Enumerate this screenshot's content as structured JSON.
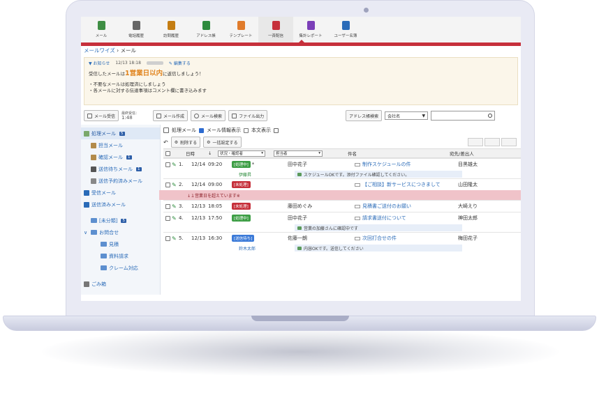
{
  "app": {
    "nav": [
      {
        "label": "メール",
        "icon": "mail-icon",
        "color": "#3f8e44"
      },
      {
        "label": "電話履歴",
        "icon": "phone-log-icon",
        "color": "#666666"
      },
      {
        "label": "訪問履歴",
        "icon": "visit-log-icon",
        "color": "#c47d12"
      },
      {
        "label": "アドレス帳",
        "icon": "address-book-icon",
        "color": "#2e8b3e"
      },
      {
        "label": "テンプレート",
        "icon": "template-icon",
        "color": "#e07b2b"
      },
      {
        "label": "一斉配信",
        "icon": "broadcast-icon",
        "color": "#c6303b"
      },
      {
        "label": "集計レポート",
        "icon": "report-icon",
        "color": "#7b3fb8"
      },
      {
        "label": "ユーザー名簿",
        "icon": "user-list-icon",
        "color": "#2a6bb8"
      }
    ],
    "accent_color": "#c6303b",
    "breadcrumb": {
      "parent": "メールワイズ",
      "sep": "›",
      "current": "メール"
    },
    "notice": {
      "toggle": "▼ お知らせ",
      "datetime": "12/13 18:18",
      "edit_label": "編集する",
      "line1_pre": "受信したメールは",
      "line1_big": "1営業日以内",
      "line1_post": "に返信しましょう！",
      "line2": "・不要なメールは処理済にしましょう",
      "line3": "・各メールに対する伝達事項はコメント欄に書き込みます"
    },
    "toolbar": {
      "receive": "メール受信",
      "last_received_label": "最終受信：",
      "last_received_time": "1:48",
      "compose": "メール作成",
      "search": "メール検索",
      "file_export": "ファイル出力",
      "address_search": "アドレス帳検索",
      "company_select": "会社名",
      "search_input_value": ""
    },
    "sidebar": {
      "items": [
        {
          "label": "処理メール",
          "badge": "5"
        },
        {
          "label": "担当メール",
          "badge": ""
        },
        {
          "label": "確認メール",
          "badge": "1"
        },
        {
          "label": "送信待ちメール",
          "badge": "1"
        },
        {
          "label": "送信予約済みメール",
          "badge": ""
        },
        {
          "label": "受信メール",
          "badge": ""
        },
        {
          "label": "送信済みメール",
          "badge": ""
        },
        {
          "label": "[未分類]",
          "badge": "5"
        },
        {
          "label": "お問合せ",
          "badge": ""
        },
        {
          "label": "見積",
          "badge": ""
        },
        {
          "label": "資料請求",
          "badge": ""
        },
        {
          "label": "クレーム対応",
          "badge": ""
        },
        {
          "label": "ごみ箱",
          "badge": ""
        }
      ]
    },
    "list": {
      "title": "処理メール",
      "show_info_label": "メール情報表示",
      "show_body_label": "本文表示",
      "delete_label": "削除する",
      "bulk_label": "一括設定する",
      "headers": {
        "datetime": "日時",
        "sort": "↓",
        "status": "状況・確認者",
        "responsible": "担当者",
        "subject": "件名",
        "to": "宛先/差出人"
      },
      "warn_text": "↓１営業日を超えています※",
      "rows": [
        {
          "no": "1.",
          "date": "12/14",
          "time": "09:20",
          "status": "[処理中]",
          "status_kind": "proc",
          "star": "*",
          "responsible": "田中花子",
          "subject": "制作スケジュールの件",
          "to": "目黒雄太",
          "sub_person": "伊藤昇",
          "comment": "スケジュールOKです。添付ファイル確認してください。"
        },
        {
          "no": "2.",
          "date": "12/14",
          "time": "09:00",
          "status": "[未処理]",
          "status_kind": "new",
          "star": "",
          "responsible": "",
          "subject": "【ご相談】新サービスにつきまして",
          "to": "山田隆太",
          "sub_person": "",
          "comment": ""
        },
        {
          "no": "3.",
          "date": "12/13",
          "time": "18:05",
          "status": "[未処理]",
          "status_kind": "new",
          "star": "",
          "responsible": "藤田めぐみ",
          "subject": "見積書ご送付のお願い",
          "to": "大崎えり",
          "sub_person": "",
          "comment": ""
        },
        {
          "no": "4.",
          "date": "12/13",
          "time": "17:50",
          "status": "[処理中]",
          "status_kind": "proc",
          "star": "",
          "responsible": "田中花子",
          "subject": "請求書送付について",
          "to": "神田太郎",
          "sub_person": "",
          "comment": "営業の加藤さんに確認中です"
        },
        {
          "no": "5.",
          "date": "12/13",
          "time": "16:30",
          "status": "[送信待ち]",
          "status_kind": "wait",
          "star": "",
          "responsible": "佐藤一朗",
          "subject": "次回打合せの件",
          "to": "梅田花子",
          "sub_person": "鈴木太郎",
          "comment": "内容OKです。送信してください"
        }
      ]
    }
  }
}
